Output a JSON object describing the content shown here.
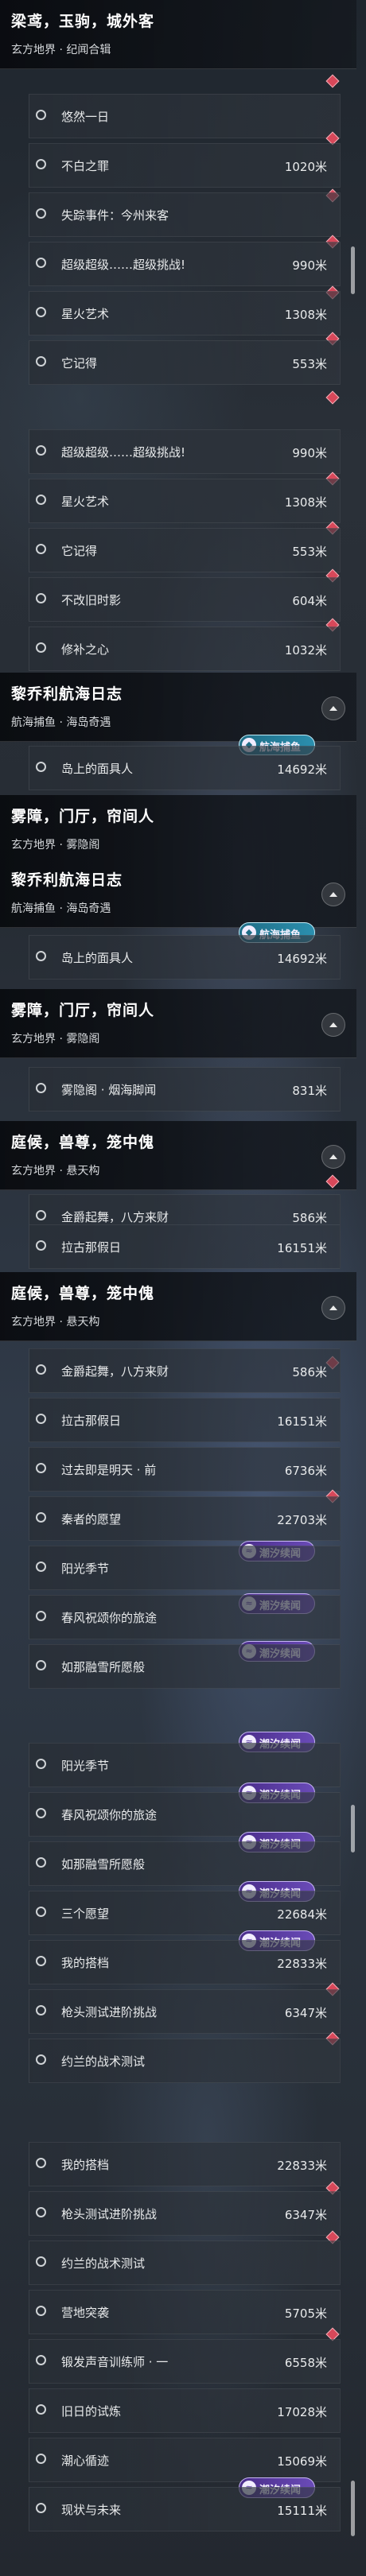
{
  "sections": {
    "s1": {
      "title": "梁鸢，玉驹，城外客",
      "sub": "玄方地界 · 纪闻合辑"
    },
    "s2": {
      "title": "黎乔利航海日志",
      "sub": "航海捕鱼 · 海岛奇遇"
    },
    "s3": {
      "title": "雾障，门厅，帘间人",
      "sub": "玄方地界 · 雾隐阁"
    },
    "s4": {
      "title": "庭候，兽尊，笼中傀",
      "sub": "玄方地界 · 悬天构"
    }
  },
  "quests": {
    "wuran": {
      "name": "悠然一日",
      "dist": ""
    },
    "buzhi": {
      "name": "不白之罪",
      "dist": "1020米"
    },
    "shizong": {
      "name": "失踪事件：今州来客",
      "dist": ""
    },
    "chaoji": {
      "name": "超级超级……超级挑战!",
      "dist": "990米"
    },
    "xinghuo": {
      "name": "星火艺术",
      "dist": "1308米"
    },
    "taji": {
      "name": "它记得",
      "dist": "553米"
    },
    "buzai": {
      "name": "不改旧时影",
      "dist": "604米"
    },
    "xiuwai": {
      "name": "修补之心",
      "dist": "1032米"
    },
    "daoshang": {
      "name": "岛上的面具人",
      "dist": "14692米"
    },
    "wuyinge": {
      "name": "雾隐阁 · 烟海脚闻",
      "dist": "831米"
    },
    "jindian": {
      "name": "金爵起舞，八方来财",
      "dist": "586米"
    },
    "lagu": {
      "name": "拉古那假日",
      "dist": "16151米"
    },
    "guoqu": {
      "name": "过去即是明天 · 前",
      "dist": "6736米"
    },
    "qinzhe": {
      "name": "秦者的愿望",
      "dist": "22703米"
    },
    "yangguang": {
      "name": "阳光季节",
      "dist": ""
    },
    "chunfeng": {
      "name": "春风祝颂你的旅途",
      "dist": ""
    },
    "rujing": {
      "name": "如那融雪所愿般",
      "dist": ""
    },
    "sange": {
      "name": "三个愿望",
      "dist": "22684米"
    },
    "wode": {
      "name": "我的搭档",
      "dist": "22833米"
    },
    "qiangtou": {
      "name": "枪头测试进阶挑战",
      "dist": "6347米"
    },
    "yuelan": {
      "name": "约兰的战术测试",
      "dist": ""
    },
    "yingdi": {
      "name": "营地突袭",
      "dist": "5705米"
    },
    "duanzao": {
      "name": "锻发声音训练师 · 一",
      "dist": "6558米"
    },
    "jiuri": {
      "name": "旧日的试炼",
      "dist": "17028米"
    },
    "chaoxin": {
      "name": "潮心循迹",
      "dist": "15069米"
    },
    "xianzhuang": {
      "name": "现状与未来",
      "dist": "15111米"
    }
  },
  "badges": {
    "tide": "潮汐续闻",
    "sea": "航海捕鱼"
  },
  "colors": {
    "marker": "#d8485a",
    "badge_purple": "#5a3aa6",
    "badge_teal": "#2b8fae",
    "panel": "#1b2128"
  }
}
